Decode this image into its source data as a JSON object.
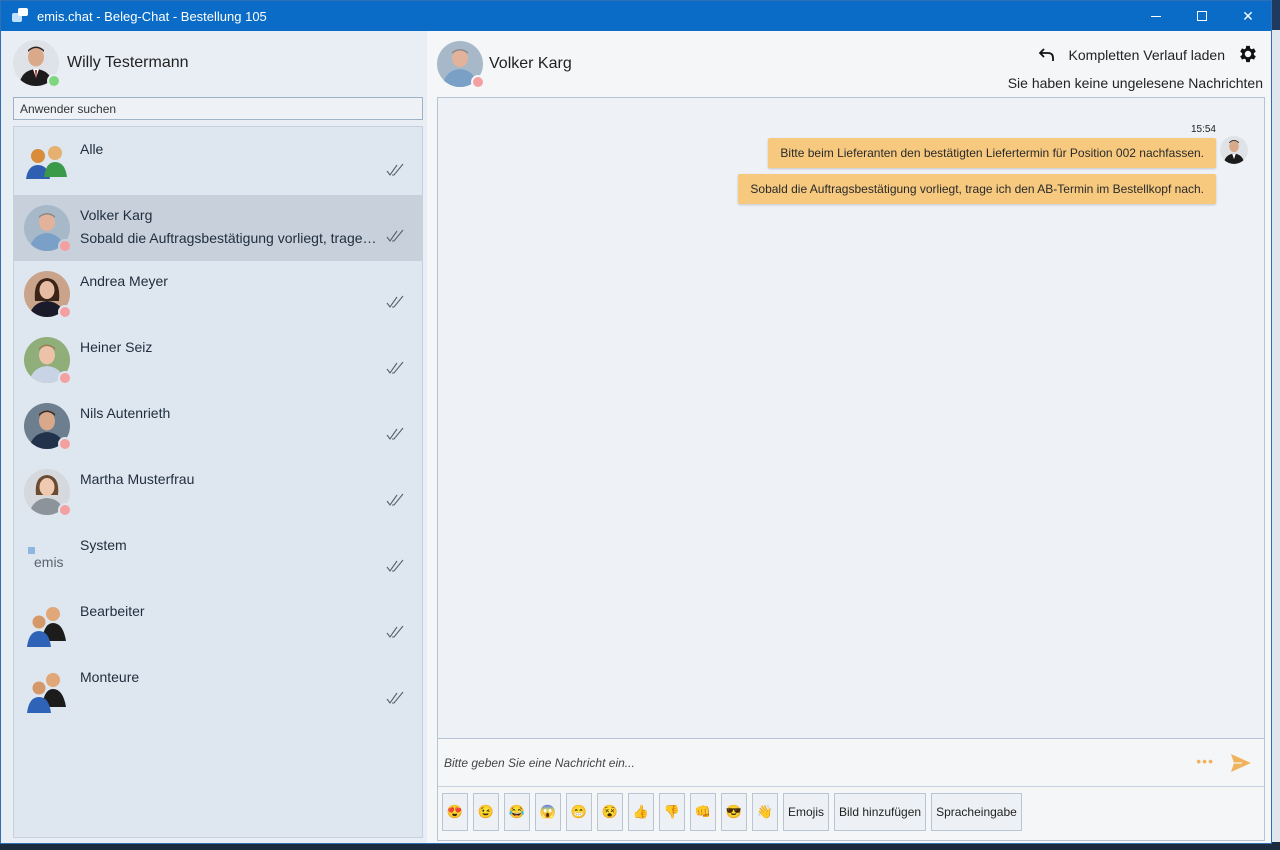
{
  "window": {
    "title": "emis.chat - Beleg-Chat - Bestellung 105",
    "close_glyph": "✕"
  },
  "colors": {
    "titlebar": "#0a6cc7",
    "online": "#7dd87d",
    "offline": "#f4a0a0",
    "bubble": "#f6c97f",
    "accent": "#f0b25c"
  },
  "sidebar": {
    "me_name": "Willy Testermann",
    "search_placeholder": "Anwender suchen",
    "contacts": [
      {
        "name": "Alle",
        "preview": "",
        "icon": "group-icon"
      },
      {
        "name": "Volker Karg",
        "preview": "Sobald die Auftragsbestätigung vorliegt, trage ich den AB-Termin im Bestellkopf nach.",
        "icon": "avatar"
      },
      {
        "name": "Andrea Meyer",
        "preview": "",
        "icon": "avatar"
      },
      {
        "name": "Heiner Seiz",
        "preview": "",
        "icon": "avatar"
      },
      {
        "name": "Nils Autenrieth",
        "preview": "",
        "icon": "avatar"
      },
      {
        "name": "Martha Musterfrau",
        "preview": "",
        "icon": "avatar"
      },
      {
        "name": "System",
        "preview": "",
        "icon": "emis-logo-icon"
      },
      {
        "name": "Bearbeiter",
        "preview": "",
        "icon": "team-icon"
      },
      {
        "name": "Monteure",
        "preview": "",
        "icon": "team-icon"
      }
    ]
  },
  "system_logo_text": "emis",
  "chat": {
    "partner_name": "Volker Karg",
    "load_history_label": "Kompletten Verlauf laden",
    "unread_text": "Sie haben keine ungelesene Nachrichten",
    "timestamp": "15:54",
    "messages": [
      "Bitte beim Lieferanten den bestätigten Liefertermin für Position 002 nachfassen.",
      "Sobald die Auftragsbestätigung vorliegt, trage ich den AB-Termin im Bestellkopf nach."
    ],
    "input_placeholder": "Bitte geben Sie eine Nachricht ein...",
    "more_glyph": "•••"
  },
  "toolbar": {
    "emojis": [
      "😍",
      "😉",
      "😂",
      "😱",
      "😁",
      "😵",
      "👍",
      "👎",
      "👊",
      "😎",
      "👋"
    ],
    "emojis_label": "Emojis",
    "add_image_label": "Bild hinzufügen",
    "voice_label": "Spracheingabe"
  }
}
